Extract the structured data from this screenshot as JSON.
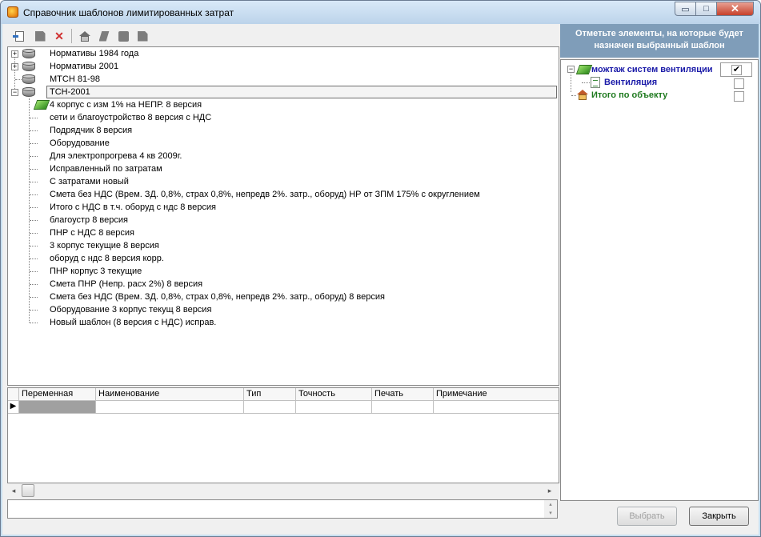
{
  "window": {
    "title": "Справочник шаблонов лимитированных затрат",
    "controls": {
      "minimize": "▭",
      "maximize": "□",
      "close": "✕"
    }
  },
  "toolbar": {
    "buttons": [
      {
        "name": "import-button",
        "icon": "import-icon"
      },
      {
        "name": "add-button",
        "icon": "add-icon"
      },
      {
        "name": "delete-button",
        "icon": "delete-icon",
        "glyph": "✕",
        "color": "#d03030"
      },
      {
        "name": "home-button",
        "icon": "house-icon"
      },
      {
        "name": "edit-button",
        "icon": "edit-icon"
      },
      {
        "name": "copy-button",
        "icon": "copy-icon"
      },
      {
        "name": "page-button",
        "icon": "page-icon"
      }
    ]
  },
  "tree": {
    "roots": [
      {
        "label": "Нормативы 1984 года",
        "expander": "+"
      },
      {
        "label": "Нормативы 2001",
        "expander": "+"
      },
      {
        "label": "МТСН 81-98",
        "expander": ""
      },
      {
        "label": "ТСН-2001",
        "expander": "−",
        "selected": true
      }
    ],
    "children": [
      "4 корпус с изм 1% на НЕПР. 8 версия",
      "сети и благоустройство 8 версия с НДС",
      "Подрядчик 8 версия",
      "Оборудование",
      "Для электропрогрева 4 кв 2009г.",
      "Исправленный по затратам",
      "С затратами новый",
      "Смета без НДС (Врем. ЗД. 0,8%, страх 0,8%, непредв 2%. затр., оборуд) НР от ЗПМ 175% с округлением",
      "Итого с НДС в т.ч. оборуд с ндс 8 версия",
      "благоустр 8 версия",
      "ПНР с НДС 8 версия",
      "3 корпус текущие 8 версия",
      "оборуд с ндс 8 версия корр.",
      "ПНР корпус 3 текущие",
      "Смета ПНР (Непр. расх 2%) 8 версия",
      "Смета без НДС (Врем. ЗД. 0,8%, страх 0,8%, непредв 2%. затр., оборуд)  8 версия",
      "Оборудование 3 корпус текущ 8 версия",
      "Новый шаблон (8 версия с НДС) исправ."
    ]
  },
  "grid": {
    "columns": [
      "Переменная",
      "Наименование",
      "Тип",
      "Точность",
      "Печать",
      "Примечание"
    ],
    "row_indicator": "▶"
  },
  "right_panel": {
    "header": "Отметьте элементы, на которые будет назначен выбранный шаблон",
    "items": [
      {
        "label": "можтаж систем вентиляции",
        "checked": true,
        "color": "#1a1aa8",
        "expander": "−"
      },
      {
        "label": "Вентиляция",
        "checked": false,
        "color": "#1a1aa8"
      },
      {
        "label": "Итого по объекту",
        "checked": false,
        "color": "#1f7a1f"
      }
    ],
    "check_glyph": "✔"
  },
  "buttons": {
    "select": "Выбрать",
    "close": "Закрыть"
  },
  "scroll": {
    "left": "◂",
    "right": "▸",
    "up": "▴",
    "down": "▾"
  }
}
